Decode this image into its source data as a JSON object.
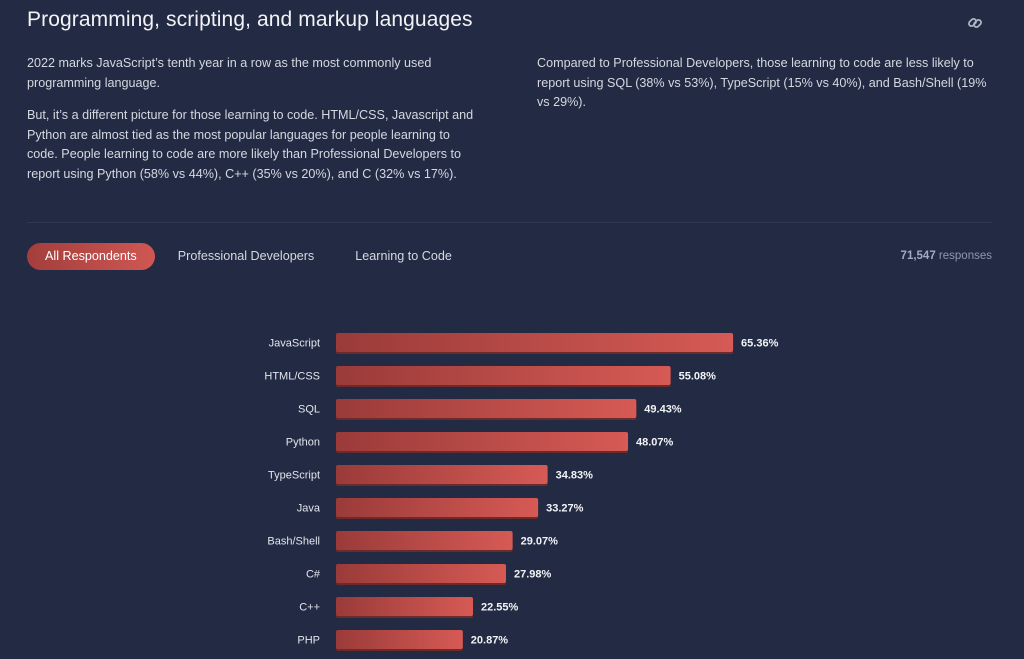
{
  "header": {
    "title": "Programming, scripting, and markup languages",
    "link_icon": "link-icon"
  },
  "intro": {
    "paragraph1": "2022 marks JavaScript’s tenth year in a row as the most commonly used programming language.",
    "paragraph2": "But, it’s a different picture for those learning to code. HTML/CSS, Javascript and Python are almost tied as the most popular languages for people learning to code. People learning to code are more likely than Professional Developers to report using Python (58% vs 44%), C++ (35% vs 20%), and C (32% vs 17%).",
    "paragraph3": "Compared to Professional Developers, those learning to code are less likely to report using SQL (38% vs 53%), TypeScript (15% vs 40%), and Bash/Shell (19% vs 29%)."
  },
  "tabs": [
    {
      "label": "All Respondents",
      "active": true
    },
    {
      "label": "Professional Developers",
      "active": false
    },
    {
      "label": "Learning to Code",
      "active": false
    }
  ],
  "responses": {
    "count": "71,547",
    "suffix": " responses"
  },
  "colors": {
    "background": "#232b44",
    "bar_start": "#9a3b39",
    "bar_end": "#d65a55",
    "active_tab": "#c24e4b"
  },
  "chart_data": {
    "type": "bar",
    "orientation": "horizontal",
    "title": "",
    "xlabel": "",
    "ylabel": "",
    "categories": [
      "JavaScript",
      "HTML/CSS",
      "SQL",
      "Python",
      "TypeScript",
      "Java",
      "Bash/Shell",
      "C#",
      "C++",
      "PHP"
    ],
    "values": [
      65.36,
      55.08,
      49.43,
      48.07,
      34.83,
      33.27,
      29.07,
      27.98,
      22.55,
      20.87
    ],
    "value_labels": [
      "65.36%",
      "55.08%",
      "49.43%",
      "48.07%",
      "34.83%",
      "33.27%",
      "29.07%",
      "27.98%",
      "22.55%",
      "20.87%"
    ],
    "unit": "%",
    "xlim": [
      0,
      100
    ],
    "grid": false,
    "legend": "none"
  }
}
